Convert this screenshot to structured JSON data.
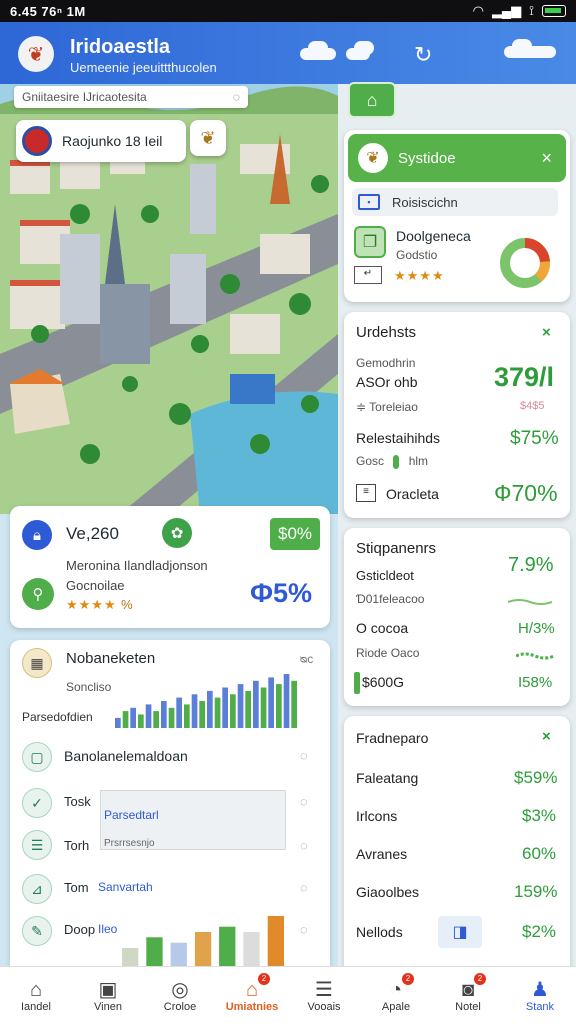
{
  "status": {
    "time": "6.45 76ⁿ 1M",
    "signal": "wifi signal",
    "battery": "battery"
  },
  "header": {
    "title": "Iridoaestla",
    "subtitle": "Uemeenie jeeuittthucolen"
  },
  "map": {
    "search_placeholder": "Gniitaesire IJricaotesita",
    "location_label": "Raojunko 18 Ieil"
  },
  "stat_card": {
    "top_value": "Ve,260",
    "badge": "$0%",
    "desc": "Meronina Ilandladjonson",
    "sub": "Gocnoilae",
    "stars": "★★★★",
    "star_pct": "%",
    "big_pct": "Ф5%"
  },
  "chart_card": {
    "title": "Nobaneketen",
    "close": "ᴓᴄ",
    "series_label": "Soncliso",
    "axis_label": "Parsedofdien",
    "rows": [
      {
        "label": "Banolanelemaldoan"
      },
      {
        "label": "Tosk",
        "tag": "Parsedtarl"
      },
      {
        "label": "Torh",
        "tag": "Prsrrsesnjo"
      },
      {
        "label": "Tom",
        "tag": "Sanvartah"
      },
      {
        "label": "Doop",
        "tag": "Ileo"
      }
    ]
  },
  "chart_data": {
    "type": "bar",
    "values": [
      3,
      5,
      6,
      4,
      7,
      5,
      8,
      6,
      9,
      7,
      10,
      8,
      11,
      9,
      12,
      10,
      13,
      11,
      14,
      12,
      15,
      13,
      16,
      14
    ],
    "lower_values": [
      6,
      8,
      7,
      9,
      10,
      9,
      12
    ]
  },
  "right": {
    "card1": {
      "title": "Systidoe",
      "close": "×",
      "field": "Roisiscichn",
      "name": "Doolgeneca",
      "sub": "Godstio",
      "stars": "★★★★"
    },
    "card2": {
      "title": "Urdehsts",
      "close": "×",
      "r1_label": "Gemodhrin",
      "r1_sub": "ASOr ohb",
      "r1_value": "379/l",
      "r2_small": "≑ Toreleiao",
      "r2_tag": "$4$5",
      "r3_label": "Relestaihihds",
      "r3_value": "$75%",
      "r4_small": "Gosc",
      "r4_sub": "hlm",
      "r5_label": "Oracleta",
      "r5_value": "Ф70%"
    },
    "card3": {
      "title": "Stiqpanenrs",
      "r1_label": "Gsticldeot",
      "r1_value": "7.9%",
      "r2_small": "Ɗ01feleacoo",
      "r3_label": "O cocoa",
      "r3_value": "H/3%",
      "r4_small": "Riode Oaco",
      "r5_label": "$600G",
      "r5_value": "I58%"
    },
    "card4": {
      "title": "Fradneparo",
      "close": "×",
      "rows": [
        {
          "label": "Faleatang",
          "value": "$59%"
        },
        {
          "label": "Irlcons",
          "value": "$3%"
        },
        {
          "label": "Avranes",
          "value": "60%"
        },
        {
          "label": "Giaoolbes",
          "value": "159%"
        },
        {
          "label": "Nellods",
          "value": "$2%"
        }
      ]
    }
  },
  "nav": [
    {
      "label": "Iandel",
      "icon": "home-icon"
    },
    {
      "label": "Vinen",
      "icon": "vinen-icon"
    },
    {
      "label": "Croloe",
      "icon": "globe-icon"
    },
    {
      "label": "Umiatnies",
      "icon": "store-icon",
      "badge": "2"
    },
    {
      "label": "Vooais",
      "icon": "list-icon"
    },
    {
      "label": "Apale",
      "icon": "chat-icon",
      "badge": "2"
    },
    {
      "label": "Notel",
      "icon": "bag-icon",
      "badge": "2"
    },
    {
      "label": "Stank",
      "icon": "people-icon"
    }
  ]
}
